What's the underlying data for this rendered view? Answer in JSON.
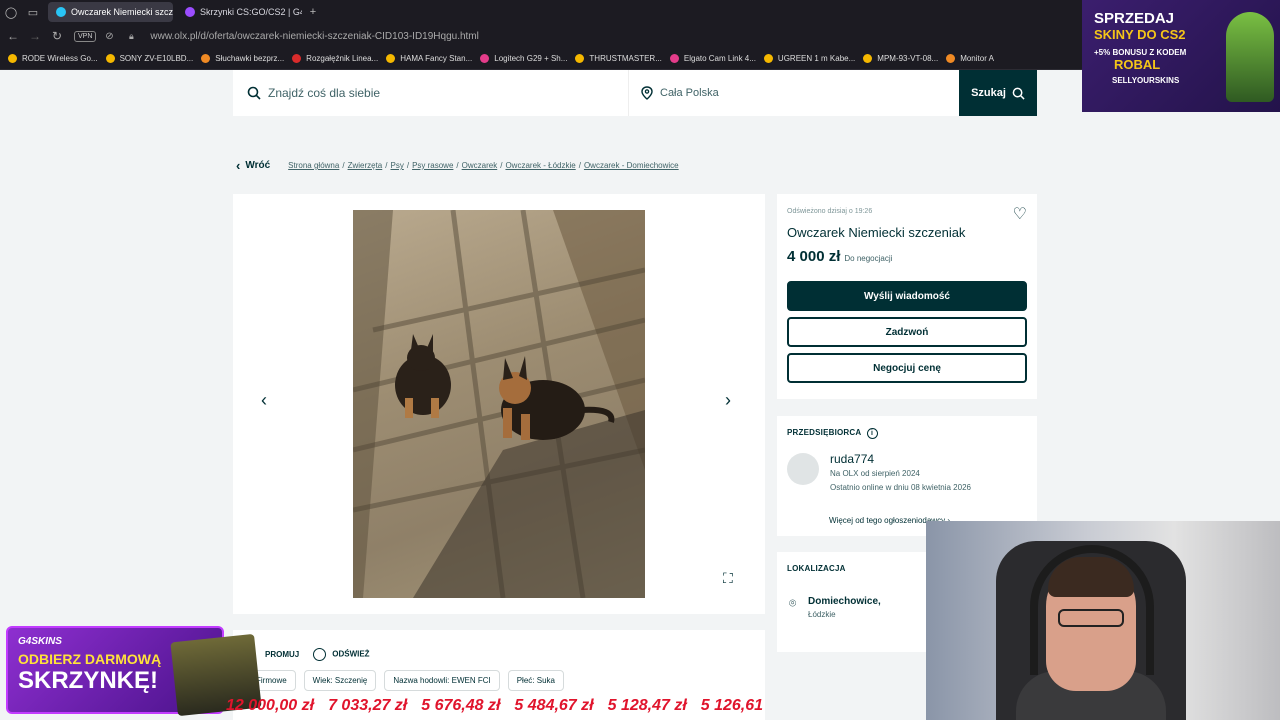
{
  "browser": {
    "tabs": [
      {
        "label": "Owczarek Niemiecki szcz",
        "active": true,
        "color": "#29c5f6"
      },
      {
        "label": "Skrzynki CS:GO/CS2 | G4",
        "active": false,
        "color": "#9b4dff"
      }
    ],
    "new_tab": "+",
    "vpn": "VPN",
    "url": "www.olx.pl/d/oferta/owczarek-niemiecki-szczeniak-CID103-ID19Hqgu.html",
    "bookmarks": [
      "RODE Wireless Go...",
      "SONY ZV-E10LBD...",
      "Słuchawki bezprz...",
      "Rozgałęźnik Linea...",
      "HAMA Fancy Stan...",
      "Logitech G29 + Sh...",
      "THRUSTMASTER...",
      "Elgato Cam Link 4...",
      "UGREEN 1 m Kabe...",
      "MPM-93-VT-08...",
      "Monitor A"
    ]
  },
  "search": {
    "placeholder": "Znajdź coś dla siebie",
    "location": "Cała Polska",
    "button": "Szukaj"
  },
  "breadcrumb": {
    "back": "Wróć",
    "items": [
      "Strona główna",
      "Zwierzęta",
      "Psy",
      "Psy rasowe",
      "Owczarek",
      "Owczarek - Łódzkie",
      "Owczarek - Domiechowice"
    ]
  },
  "listing": {
    "refreshed": "Odświeżono dzisiaj o 19:26",
    "title": "Owczarek Niemiecki szczeniak",
    "price": "4 000 zł",
    "negotiable": "Do negocjacji",
    "btn_message": "Wyślij wiadomość",
    "btn_call": "Zadzwoń",
    "btn_negotiate": "Negocjuj cenę"
  },
  "seller": {
    "heading": "PRZEDSIĘBIORCA",
    "name": "ruda774",
    "since": "Na OLX od sierpień 2024",
    "online": "Ostatnio online w dniu 08 kwietnia 2026",
    "more": "Więcej od tego ogłoszeniodawcy"
  },
  "location": {
    "heading": "LOKALIZACJA",
    "city": "Domiechowice,",
    "region": "Łódzkie"
  },
  "params": {
    "promote": "PROMUJ",
    "refresh": "ODŚWIEŻ",
    "tags": [
      "Firmowe",
      "Wiek: Szczenię",
      "Nazwa hodowli: EWEN FCI",
      "Płeć: Suka"
    ]
  },
  "overlay_top": {
    "line1": "SPRZEDAJ",
    "line2": "SKINY DO CS2",
    "line3": "+5% BONUSU Z KODEM",
    "line4": "ROBAL",
    "line5": "SELLYOURSKINS"
  },
  "overlay_bottom": {
    "brand": "G4SKINS",
    "line1": "ODBIERZ DARMOWĄ",
    "line2": "SKRZYNKĘ!"
  },
  "ticker": [
    "12 000,00 zł",
    "7 033,27 zł",
    "5 676,48 zł",
    "5 484,67 zł",
    "5 128,47 zł",
    "5 126,61"
  ]
}
